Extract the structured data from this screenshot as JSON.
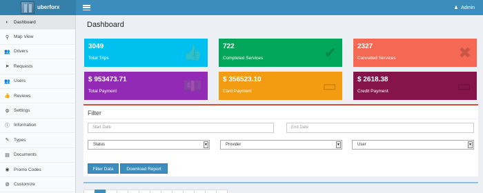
{
  "brand": {
    "name": "uberforx"
  },
  "header": {
    "user_label": "Admin"
  },
  "sidebar": {
    "items": [
      {
        "label": "Dashboard",
        "icon": "dashboard-icon",
        "glyph": "◐",
        "active": true
      },
      {
        "label": "Map View",
        "icon": "map-pin-icon",
        "glyph": "⚲"
      },
      {
        "label": "Drivers",
        "icon": "users-icon",
        "glyph": "👥"
      },
      {
        "label": "Requests",
        "icon": "location-arrow-icon",
        "glyph": "➤"
      },
      {
        "label": "Users",
        "icon": "users-icon",
        "glyph": "👥"
      },
      {
        "label": "Reviews",
        "icon": "thumbs-up-icon",
        "glyph": "👍"
      },
      {
        "label": "Settings",
        "icon": "cogs-icon",
        "glyph": "⚙"
      },
      {
        "label": "Information",
        "icon": "info-icon",
        "glyph": "ⓘ"
      },
      {
        "label": "Types",
        "icon": "tags-icon",
        "glyph": "✎"
      },
      {
        "label": "Documents",
        "icon": "documents-icon",
        "glyph": "▤"
      },
      {
        "label": "Promo Codes",
        "icon": "promo-icon",
        "glyph": "◉"
      },
      {
        "label": "Customize",
        "icon": "customize-icon",
        "glyph": "◍"
      }
    ]
  },
  "page": {
    "title": "Dashboard"
  },
  "tiles": [
    {
      "value": "3049",
      "label": "Total Trips",
      "color": "#00c0ef",
      "icon": "thumbs-up-icon",
      "glyph": "👍"
    },
    {
      "value": "722",
      "label": "Completed Services",
      "color": "#00a65a",
      "icon": "check-icon",
      "glyph": "✔"
    },
    {
      "value": "2327",
      "label": "Cancelled Services",
      "color": "#f56954",
      "icon": "close-icon",
      "glyph": "✖"
    },
    {
      "value": "$ 953473.71",
      "label": "Total Payment",
      "color": "#932ab6",
      "icon": "money-icon",
      "glyph": "💵"
    },
    {
      "value": "$ 356523.10",
      "label": "Card Payment",
      "color": "#f39c12",
      "icon": "credit-card-icon",
      "glyph": "▭"
    },
    {
      "value": "$ 2618.38",
      "label": "Credit Payment",
      "color": "#85144b",
      "icon": "credit-card-icon",
      "glyph": "▭"
    }
  ],
  "filter": {
    "title": "Filter",
    "start_date_placeholder": "Start Date",
    "end_date_placeholder": "End Date",
    "status_selected": "Status",
    "provider_selected": "Provider",
    "user_selected": "User",
    "filter_button": "Filter Data",
    "download_button": "Download Report"
  },
  "colors": {
    "header": "#3c8dbc",
    "logo_bg": "#367fa9",
    "filter_accent": "#dd4b39",
    "button": "#3c8dbc"
  }
}
